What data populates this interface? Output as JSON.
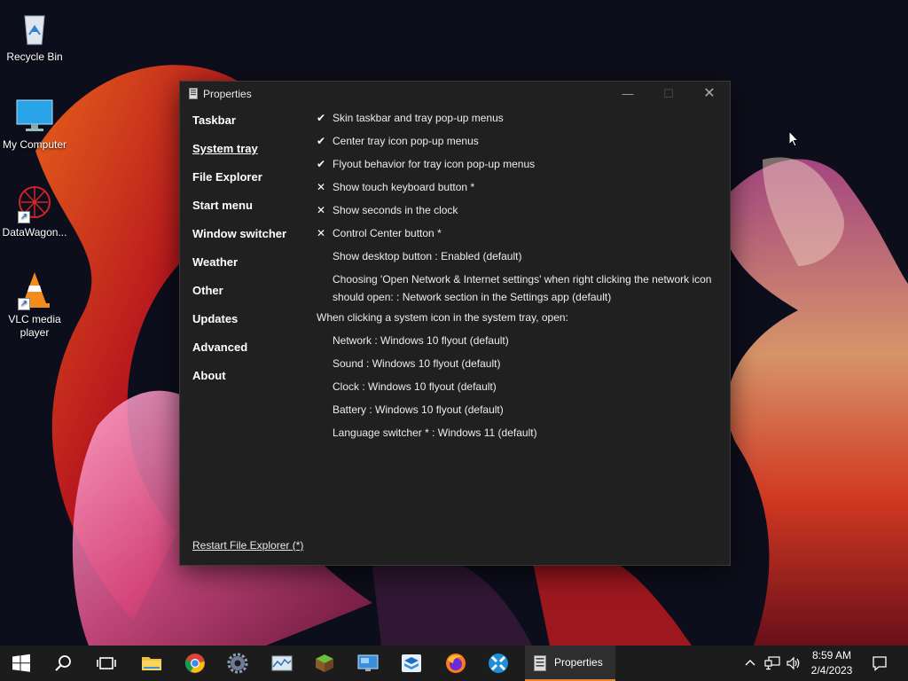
{
  "desktop": {
    "icons": [
      {
        "label": "Recycle Bin"
      },
      {
        "label": "My Computer"
      },
      {
        "label": "DataWagon..."
      },
      {
        "label": "VLC media player"
      }
    ]
  },
  "window": {
    "title": "Properties",
    "controls": {
      "minimize": "—",
      "maximize": "☐",
      "close": "✕"
    },
    "nav": [
      {
        "label": "Taskbar"
      },
      {
        "label": "System tray"
      },
      {
        "label": "File Explorer"
      },
      {
        "label": "Start menu"
      },
      {
        "label": "Window switcher"
      },
      {
        "label": "Weather"
      },
      {
        "label": "Other"
      },
      {
        "label": "Updates"
      },
      {
        "label": "Advanced"
      },
      {
        "label": "About"
      }
    ],
    "active_nav": "System tray",
    "options": [
      {
        "mark": "✔",
        "label": "Skin taskbar and tray pop-up menus"
      },
      {
        "mark": "✔",
        "label": "Center tray icon pop-up menus"
      },
      {
        "mark": "✔",
        "label": "Flyout behavior for tray icon pop-up menus"
      },
      {
        "mark": "✕",
        "label": "Show touch keyboard button *"
      },
      {
        "mark": "✕",
        "label": "Show seconds in the clock"
      },
      {
        "mark": "✕",
        "label": "Control Center button *"
      },
      {
        "mark": "",
        "label": "Show desktop button : Enabled (default)"
      },
      {
        "mark": "",
        "label": "Choosing 'Open Network & Internet settings' when right clicking the network icon should open: : Network section in the Settings app (default)"
      }
    ],
    "section_heading": "When clicking a system icon in the system tray, open:",
    "tray_options": [
      {
        "label": "Network : Windows 10 flyout (default)"
      },
      {
        "label": "Sound : Windows 10 flyout (default)"
      },
      {
        "label": "Clock : Windows 10 flyout (default)"
      },
      {
        "label": "Battery : Windows 10 flyout (default)"
      },
      {
        "label": "Language switcher * : Windows 11 (default)"
      }
    ],
    "restart_link": "Restart File Explorer (*)"
  },
  "taskbar": {
    "pinned": [
      "windows-start-icon",
      "search-icon",
      "task-view-icon",
      "file-explorer-icon",
      "chrome-icon",
      "settings-icon",
      "resource-monitor-icon",
      "minecraft-icon",
      "remote-desktop-icon",
      "sandbox-icon",
      "firefox-icon",
      "xcp-icon"
    ],
    "active_app": {
      "label": "Properties"
    },
    "tray_icons": [
      "chevron-up-icon",
      "network-icon",
      "volume-icon"
    ],
    "clock": {
      "time": "8:59 AM",
      "date": "2/4/2023"
    },
    "accent": "#e88a35"
  }
}
